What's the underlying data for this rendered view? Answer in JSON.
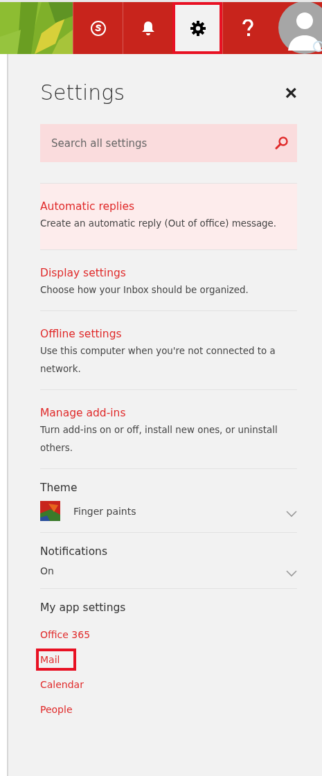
{
  "header": {
    "buttons": [
      {
        "kind": "skype",
        "selected": false
      },
      {
        "kind": "bell",
        "selected": false
      },
      {
        "kind": "gear",
        "selected": true
      },
      {
        "kind": "help",
        "selected": false
      }
    ]
  },
  "panel": {
    "title": "Settings",
    "close": "×",
    "search": {
      "placeholder": "Search all settings"
    },
    "items": [
      {
        "title": "Automatic replies",
        "description": "Create an automatic reply (Out of office) message.",
        "selected": true
      },
      {
        "title": "Display settings",
        "description": "Choose how your Inbox should be organized.",
        "selected": false
      },
      {
        "title": "Offline settings",
        "description": "Use this computer when you're not connected to a network.",
        "selected": false
      },
      {
        "title": "Manage add-ins",
        "description": "Turn add-ins on or off, install new ones, or uninstall others.",
        "selected": false
      }
    ],
    "theme": {
      "label": "Theme",
      "value": "Finger paints"
    },
    "notifications": {
      "label": "Notifications",
      "value": "On"
    },
    "app_settings": {
      "label": "My app settings",
      "links": [
        {
          "label": "Office 365",
          "selected": false
        },
        {
          "label": "Mail",
          "selected": true
        },
        {
          "label": "Calendar",
          "selected": false
        },
        {
          "label": "People",
          "selected": false
        }
      ]
    }
  }
}
